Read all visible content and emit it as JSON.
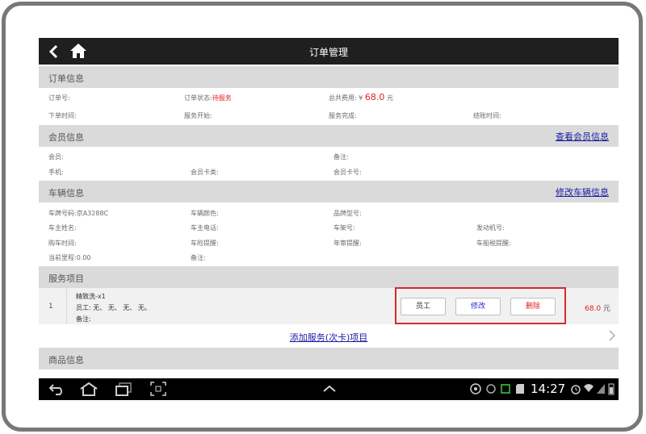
{
  "app": {
    "title": "订单管理"
  },
  "order_info": {
    "header": "订单信息",
    "order_no_label": "订单号:",
    "status_label": "订单状态:",
    "status_value": "待服务",
    "total_label": "总共费用:",
    "currency_symbol": "¥",
    "total_value": "68.0",
    "total_unit": "元",
    "order_time_label": "下单时间:",
    "service_start_label": "服务开始:",
    "service_done_label": "服务完成:",
    "checkout_time_label": "结账时间:"
  },
  "member_info": {
    "header": "会员信息",
    "link": "查看会员信息",
    "member_label": "会员:",
    "remark_label": "备注:",
    "phone_label": "手机:",
    "card_type_label": "会员卡类:",
    "card_no_label": "会员卡号:"
  },
  "vehicle_info": {
    "header": "车辆信息",
    "link": "修改车辆信息",
    "plate_label": "车牌号码:",
    "plate_value": "京A3288C",
    "color_label": "车辆颜色:",
    "brand_label": "品牌型号:",
    "owner_name_label": "车主姓名:",
    "owner_phone_label": "车主电话:",
    "frame_no_label": "车架号:",
    "engine_no_label": "发动机号:",
    "purchase_time_label": "购车时间:",
    "insurance_label": "车险提醒:",
    "annual_check_label": "年审提醒:",
    "vessel_tax_label": "车船税提醒:",
    "mileage_label": "当前里程:",
    "mileage_value": "0.00",
    "remark_label": "备注:"
  },
  "service_items": {
    "header": "服务项目",
    "items": [
      {
        "index": "1",
        "name": "精致洗-x1",
        "staff_line": "员工: 无、 无、 无、 无。",
        "remark": "备注:",
        "price": "68.0",
        "unit": "元"
      }
    ],
    "buttons": {
      "staff": "员工",
      "edit": "修改",
      "delete": "删除"
    },
    "add_link": "添加服务(次卡)项目"
  },
  "goods_info": {
    "header": "商品信息"
  },
  "status_bar": {
    "time": "14:27"
  },
  "colors": {
    "accent_red": "#e02020",
    "link_blue": "#1a1aa6",
    "highlight_red": "#d62a2a",
    "header_gray": "#dadada"
  },
  "icons": [
    "back-icon",
    "home-icon",
    "chevron-right-icon",
    "nav-back-icon",
    "nav-home-icon",
    "nav-recents-icon",
    "screenshot-icon",
    "nav-up-icon",
    "usb-icon",
    "sync-icon",
    "battery-icon",
    "alarm-icon",
    "wifi-icon",
    "signal-icon"
  ]
}
